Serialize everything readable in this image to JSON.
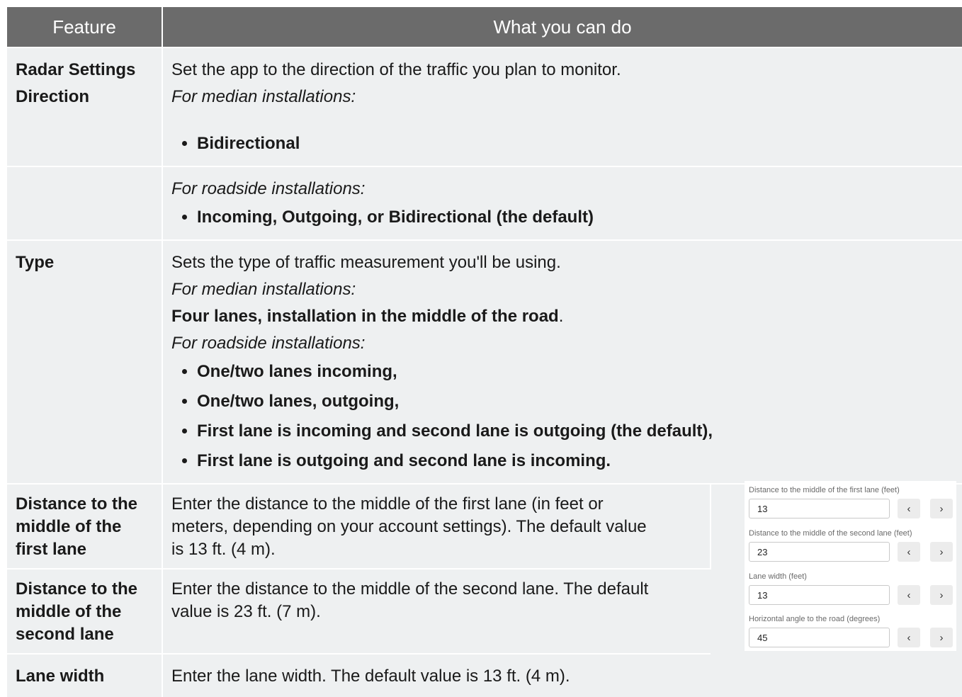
{
  "table": {
    "headers": [
      "Feature",
      "What you can do"
    ],
    "rows": {
      "direction": {
        "feature_lines": [
          "Radar Settings",
          "Direction"
        ],
        "text": "Set the app to the direction of the traffic you plan to monitor.",
        "median_label": "For median installations:",
        "median_bullets": [
          "Bidirectional"
        ]
      },
      "direction_roadside": {
        "roadside_label": "For roadside installations:",
        "roadside_bullets": [
          "Incoming, Outgoing, or Bidirectional (the default)"
        ]
      },
      "type": {
        "feature": "Type",
        "text": "Sets the type of traffic measurement you'll be using.",
        "median_label": "For median installations:",
        "median_value": "Four lanes, installation in the middle of the road",
        "median_period": ".",
        "roadside_label": "For roadside installations:",
        "roadside_bullets": [
          "One/two lanes incoming,",
          "One/two lanes, outgoing,",
          "First lane is incoming and second lane is outgoing (the default),",
          "First lane is outgoing and second lane is incoming."
        ]
      },
      "first_lane": {
        "feature_lines": [
          "Distance to the",
          "middle of the",
          "first lane"
        ],
        "text_lines": [
          "Enter the distance to the middle of the first lane (in feet or",
          "meters, depending on your account settings). The default value",
          "is 13 ft. (4 m)."
        ]
      },
      "second_lane": {
        "feature_lines": [
          "Distance to the",
          "middle of the",
          "second lane"
        ],
        "text_lines": [
          "Enter the distance to the middle of the second lane. The default",
          "value is 23 ft. (7 m)."
        ]
      },
      "lane_width": {
        "feature": "Lane width",
        "text": "Enter the lane width. The default value is 13 ft. (4 m)."
      }
    }
  },
  "settings_panel": {
    "fields": [
      {
        "label": "Distance to the middle of the first lane (feet)",
        "value": "13"
      },
      {
        "label": "Distance to the middle of the second lane (feet)",
        "value": "23"
      },
      {
        "label": "Lane width (feet)",
        "value": "13"
      },
      {
        "label": "Horizontal angle to the road (degrees)",
        "value": "45"
      }
    ],
    "decrement_glyph": "‹",
    "increment_glyph": "›"
  }
}
